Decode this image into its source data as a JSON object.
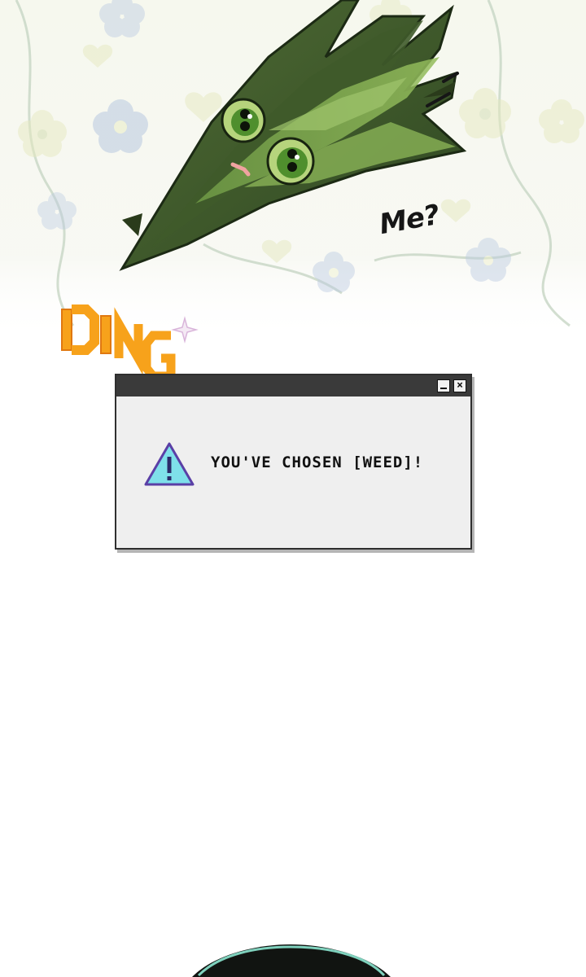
{
  "speech": {
    "text": "Me?"
  },
  "sfx": {
    "text": "DING",
    "color": "#f7a21b"
  },
  "dialog": {
    "message": "YOU'VE CHOSEN [WEED]!",
    "icon": "warning-triangle-icon",
    "minimize_icon": "minimize-icon",
    "close_icon": "close-icon",
    "close_glyph": "×",
    "titlebar_color": "#3a3a3a",
    "icon_color": "#7fe0ea"
  },
  "background": {
    "pattern": "floral-hearts",
    "colors": [
      "#c9d8e8",
      "#e8edc4",
      "#cfe0cf"
    ]
  }
}
